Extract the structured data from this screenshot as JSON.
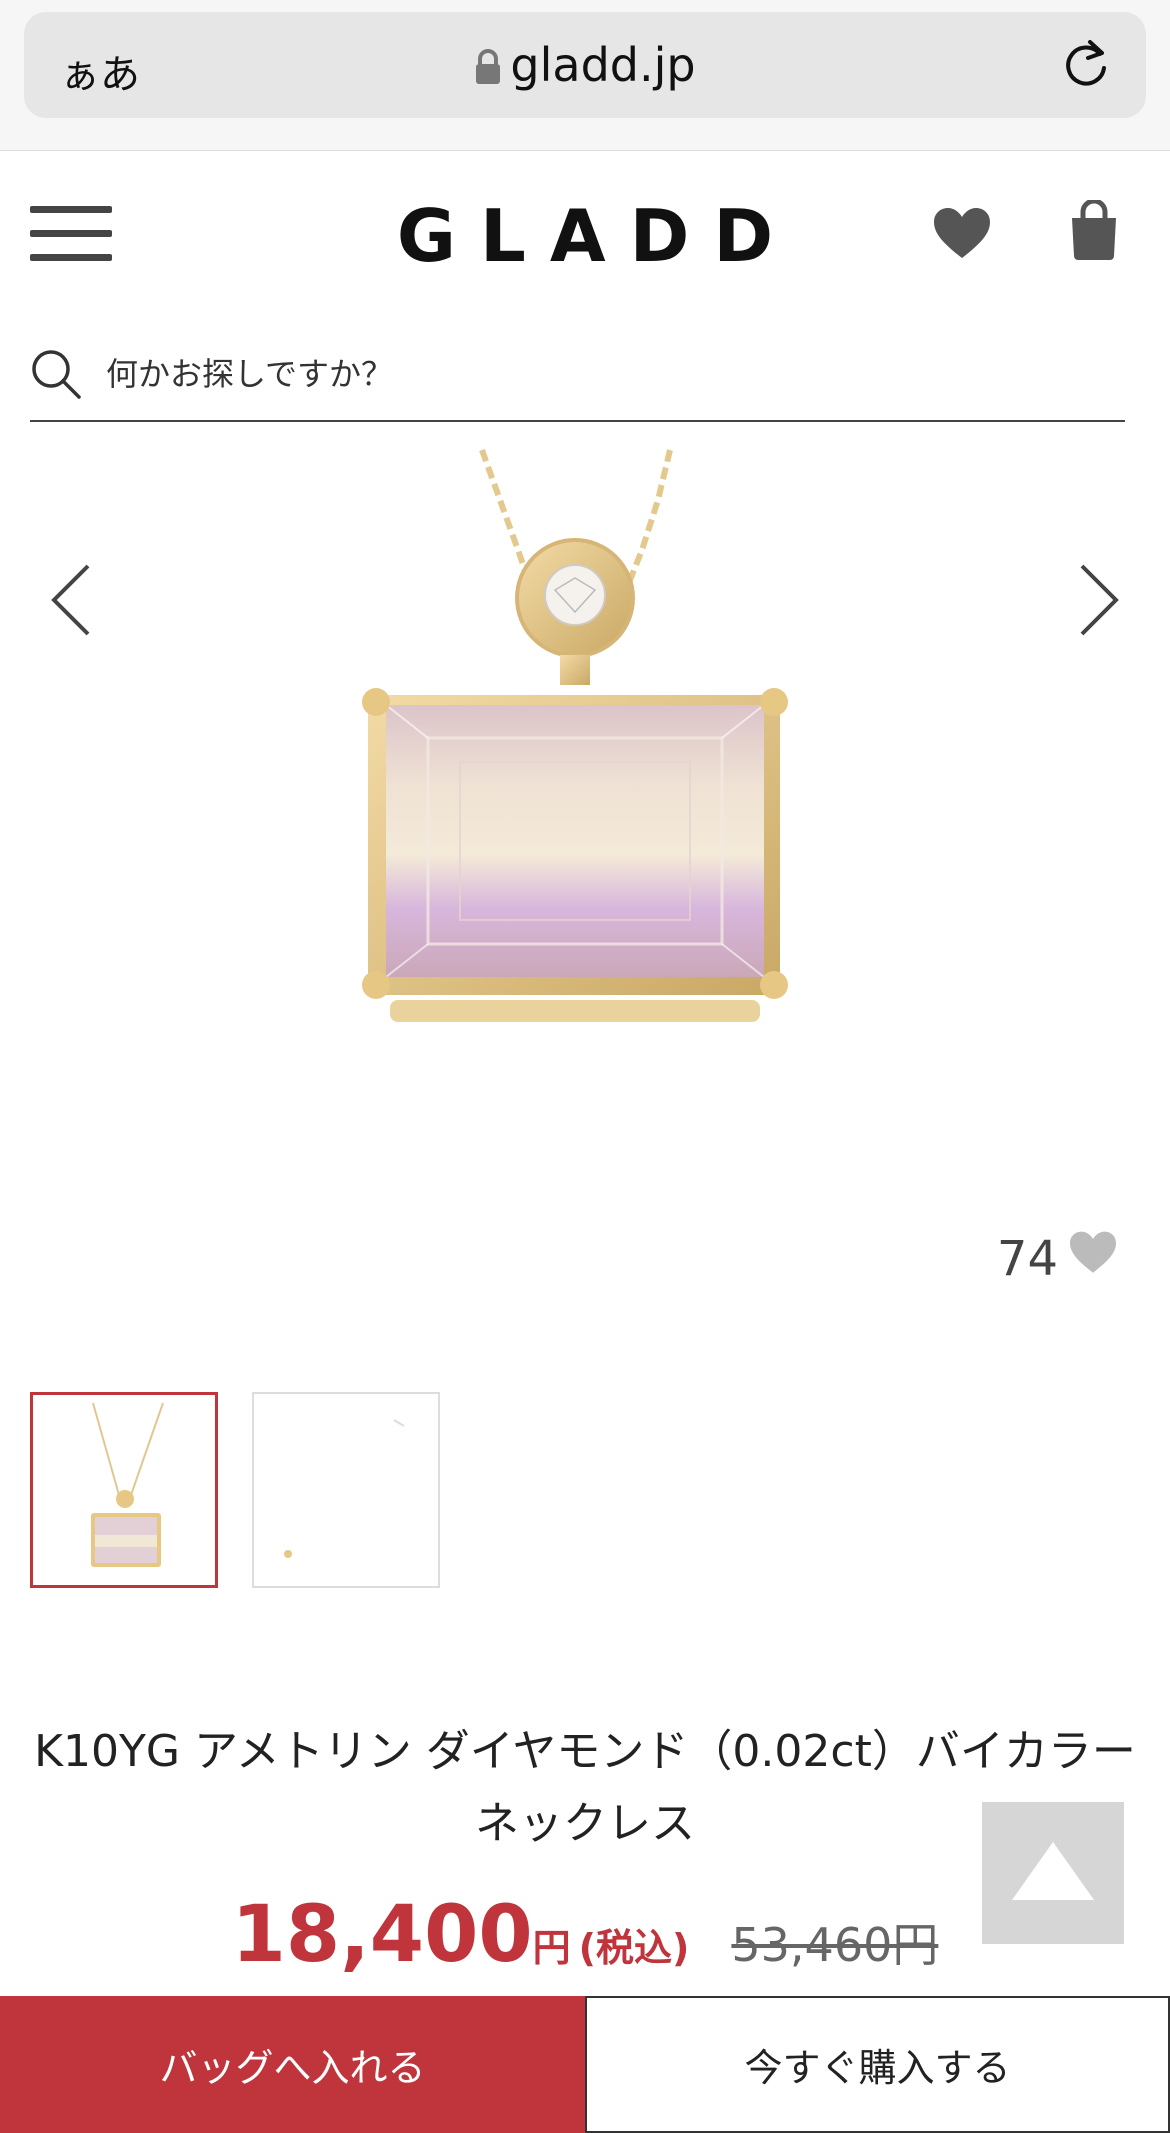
{
  "browser": {
    "aa_label": "ぁあ",
    "url": "gladd.jp"
  },
  "header": {
    "logo": "GLADD",
    "icons": [
      "menu-icon",
      "heart-icon",
      "shopping-bag-icon"
    ]
  },
  "search": {
    "placeholder": "何かお探しですか？"
  },
  "gallery": {
    "like_count": "74",
    "thumbnails_count_visible": 2
  },
  "product": {
    "title": "K10YG アメトリン ダイヤモンド（0.02ct）バイカラー ネックレス",
    "price": "18,400",
    "price_unit": "円",
    "tax_label": "(税込)",
    "original_price": "53,460円"
  },
  "actions": {
    "add_to_bag": "バッグへ入れる",
    "buy_now": "今すぐ購入する"
  },
  "colors": {
    "accent": "#c0343c",
    "icon": "#555555"
  }
}
